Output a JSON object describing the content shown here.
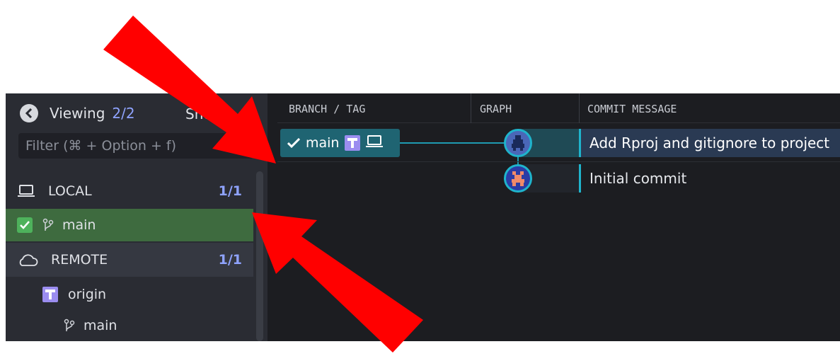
{
  "sidebar": {
    "viewing_label": "Viewing",
    "viewing_count": "2/2",
    "show_label": "Sho",
    "filter_placeholder": "Filter (⌘ + Option + f)",
    "local": {
      "label": "LOCAL",
      "count": "1/1"
    },
    "local_branch": {
      "label": "main",
      "checked": true
    },
    "remote": {
      "label": "REMOTE",
      "count": "1/1"
    },
    "remote_origin": {
      "label": "origin"
    },
    "remote_branch": {
      "label": "main"
    }
  },
  "graph_panel": {
    "columns": [
      "BRANCH / TAG",
      "GRAPH",
      "COMMIT MESSAGE"
    ],
    "branch_pill": {
      "label": "main"
    },
    "commits": [
      {
        "message": "Add Rproj and gitignore to project"
      },
      {
        "message": "Initial commit"
      }
    ]
  },
  "colors": {
    "accent": "#1fb4cc",
    "count": "#8fa3ff",
    "selected_row": "#3e6b3f",
    "arrow": "#ff0000"
  }
}
